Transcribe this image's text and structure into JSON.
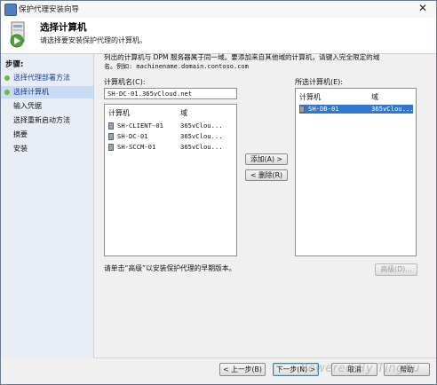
{
  "window": {
    "title": "保护代理安装向导",
    "close_glyph": "✕"
  },
  "header": {
    "title": "选择计算机",
    "subtitle": "请选择要安装保护代理的计算机。"
  },
  "sidebar": {
    "heading": "步骤:",
    "items": [
      {
        "label": "选择代理部署方法",
        "state": "done"
      },
      {
        "label": "选择计算机",
        "state": "active"
      },
      {
        "label": "输入凭据",
        "state": "todo"
      },
      {
        "label": "选择重新启动方法",
        "state": "todo"
      },
      {
        "label": "摘要",
        "state": "todo"
      },
      {
        "label": "安装",
        "state": "todo"
      }
    ]
  },
  "main": {
    "description_line1": "列出的计算机与 DPM 服务器属于同一域。要添加来自其他域的计算机，请键入完全限定的域",
    "description_line2": "名。例如: machinename.domain.contoso.com",
    "computer_name_label": "计算机名(C):",
    "computer_name_value": "SH-DC-01.365vCloud.net",
    "available": {
      "col_computer": "计算机",
      "col_domain": "域",
      "rows": [
        {
          "name": "SH-CLIENT-01",
          "domain": "365vClou..."
        },
        {
          "name": "SH-DC-01",
          "domain": "365vClou..."
        },
        {
          "name": "SH-SCCM-01",
          "domain": "365vClou..."
        }
      ]
    },
    "add_button": "添加(A) >",
    "remove_button": "< 删除(R)",
    "selected_label": "所选计算机(E):",
    "selected": {
      "col_computer": "计算机",
      "col_domain": "域",
      "rows": [
        {
          "name": "SH-DB-01",
          "domain": "365vClou..."
        }
      ]
    },
    "advanced_hint": "请单击“高级”以安装保护代理的早期版本。",
    "advanced_button": "高级(D)..."
  },
  "footer": {
    "back": "< 上一步(B)",
    "next": "下一步(N) >",
    "cancel": "取消",
    "help": "帮助"
  },
  "watermark": "Powered By TingXu",
  "colors": {
    "selection": "#3376d0",
    "sidebar_bg": "#e9eef6",
    "step_dot": "#6fb83b"
  }
}
